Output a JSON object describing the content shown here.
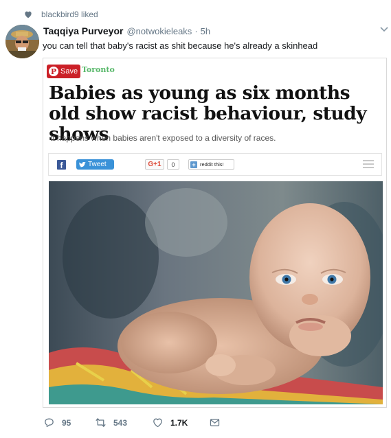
{
  "liked_by": "blackbird9 liked",
  "tweet": {
    "display_name": "Taqqiya Purveyor",
    "handle": "@notwokieleaks",
    "separator": "·",
    "time": "5h",
    "text": "you can tell that baby's racist as shit because he's already a skinhead"
  },
  "card": {
    "save_label": "Save",
    "pin_glyph": "P",
    "brand": "Toronto",
    "headline": "Babies as young as six months old show racist behaviour, study shows",
    "subhead": "It happens when babies aren't exposed to a diversity of races.",
    "share": {
      "facebook_glyph": "f",
      "tweet_label": "Tweet",
      "gplus_label": "G+1",
      "gplus_count": "0",
      "reddit_glyph": "+",
      "reddit_label": "reddit this!"
    }
  },
  "actions": {
    "replies": "95",
    "retweets": "543",
    "likes": "1.7K"
  },
  "colors": {
    "text_primary": "#14171a",
    "text_secondary": "#657786",
    "pinterest_red": "#cb2027",
    "toronto_green": "#58b86a",
    "facebook_blue": "#3b5998",
    "twitter_blue": "#3a92d8",
    "gplus_red": "#dd4b39",
    "reddit_blue": "#5f99cf"
  },
  "icons": {
    "liked": "heart-icon",
    "menu": "chevron-down-icon",
    "reply": "reply-icon",
    "retweet": "retweet-icon",
    "like": "heart-icon",
    "dm": "envelope-icon",
    "share_menu": "hamburger-icon"
  }
}
